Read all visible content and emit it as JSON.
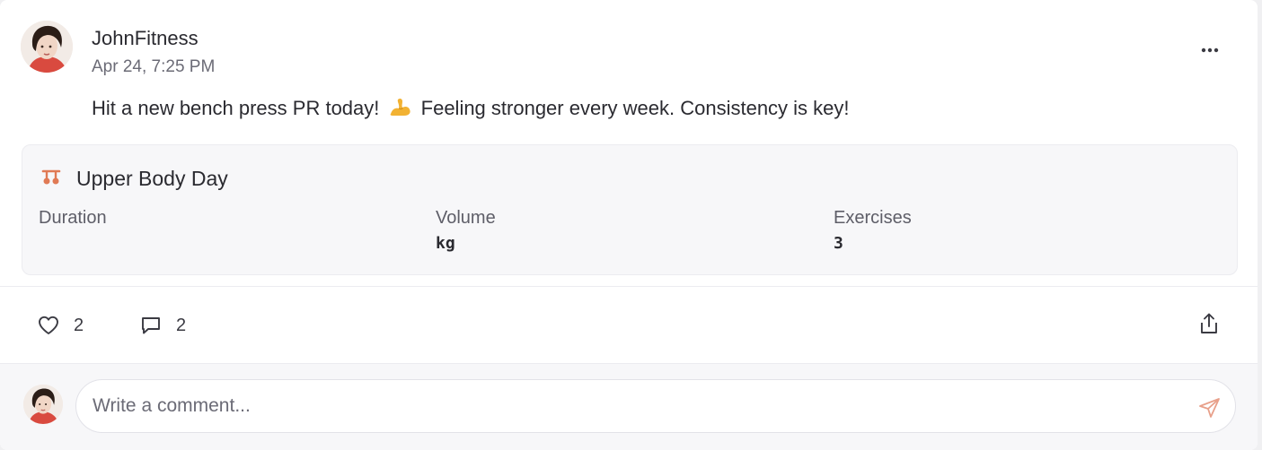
{
  "post": {
    "author": "JohnFitness",
    "timestamp": "Apr 24, 7:25 PM",
    "text_before_emoji": "Hit a new bench press PR today!",
    "emoji_name": "flexed-biceps-emoji",
    "text_after_emoji": "Feeling stronger every week. Consistency is key!"
  },
  "workout": {
    "icon": "dumbbell-icon",
    "title": "Upper Body Day",
    "stats": [
      {
        "label": "Duration",
        "value": ""
      },
      {
        "label": "Volume",
        "value": "kg"
      },
      {
        "label": "Exercises",
        "value": "3"
      }
    ]
  },
  "actions": {
    "likes": "2",
    "comments": "2"
  },
  "comment_box": {
    "placeholder": "Write a comment..."
  },
  "colors": {
    "accent": "#e07a55",
    "send_icon": "#e8a08a",
    "text_primary": "#2a2a30",
    "text_secondary": "#6b6b76"
  }
}
